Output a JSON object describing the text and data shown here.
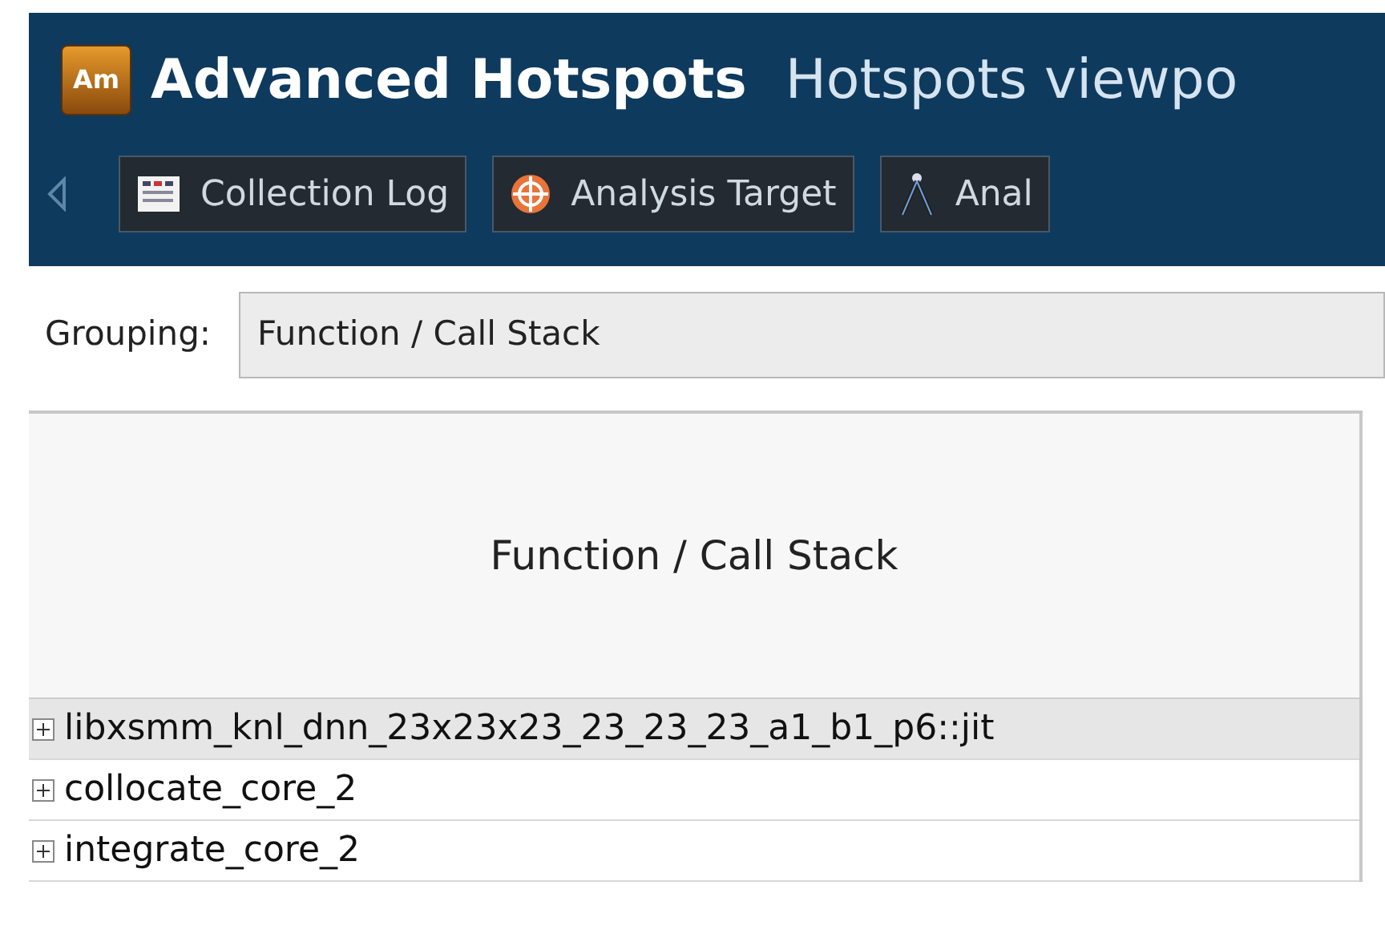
{
  "header": {
    "app_badge": "Am",
    "title": "Advanced Hotspots",
    "subtitle": "Hotspots viewpo"
  },
  "tabs": [
    {
      "label": "Collection Log",
      "selected": false
    },
    {
      "label": "Analysis Target",
      "selected": false
    },
    {
      "label": "Anal",
      "selected": false
    }
  ],
  "grouping": {
    "label": "Grouping:",
    "value": "Function / Call Stack"
  },
  "table": {
    "columns": [
      "Function / Call Stack"
    ],
    "rows": [
      {
        "name": "libxsmm_knl_dnn_23x23x23_23_23_23_a1_b1_p6::jit",
        "expanded": false,
        "selected": true
      },
      {
        "name": "collocate_core_2",
        "expanded": false,
        "selected": false
      },
      {
        "name": "integrate_core_2",
        "expanded": false,
        "selected": false
      }
    ]
  }
}
